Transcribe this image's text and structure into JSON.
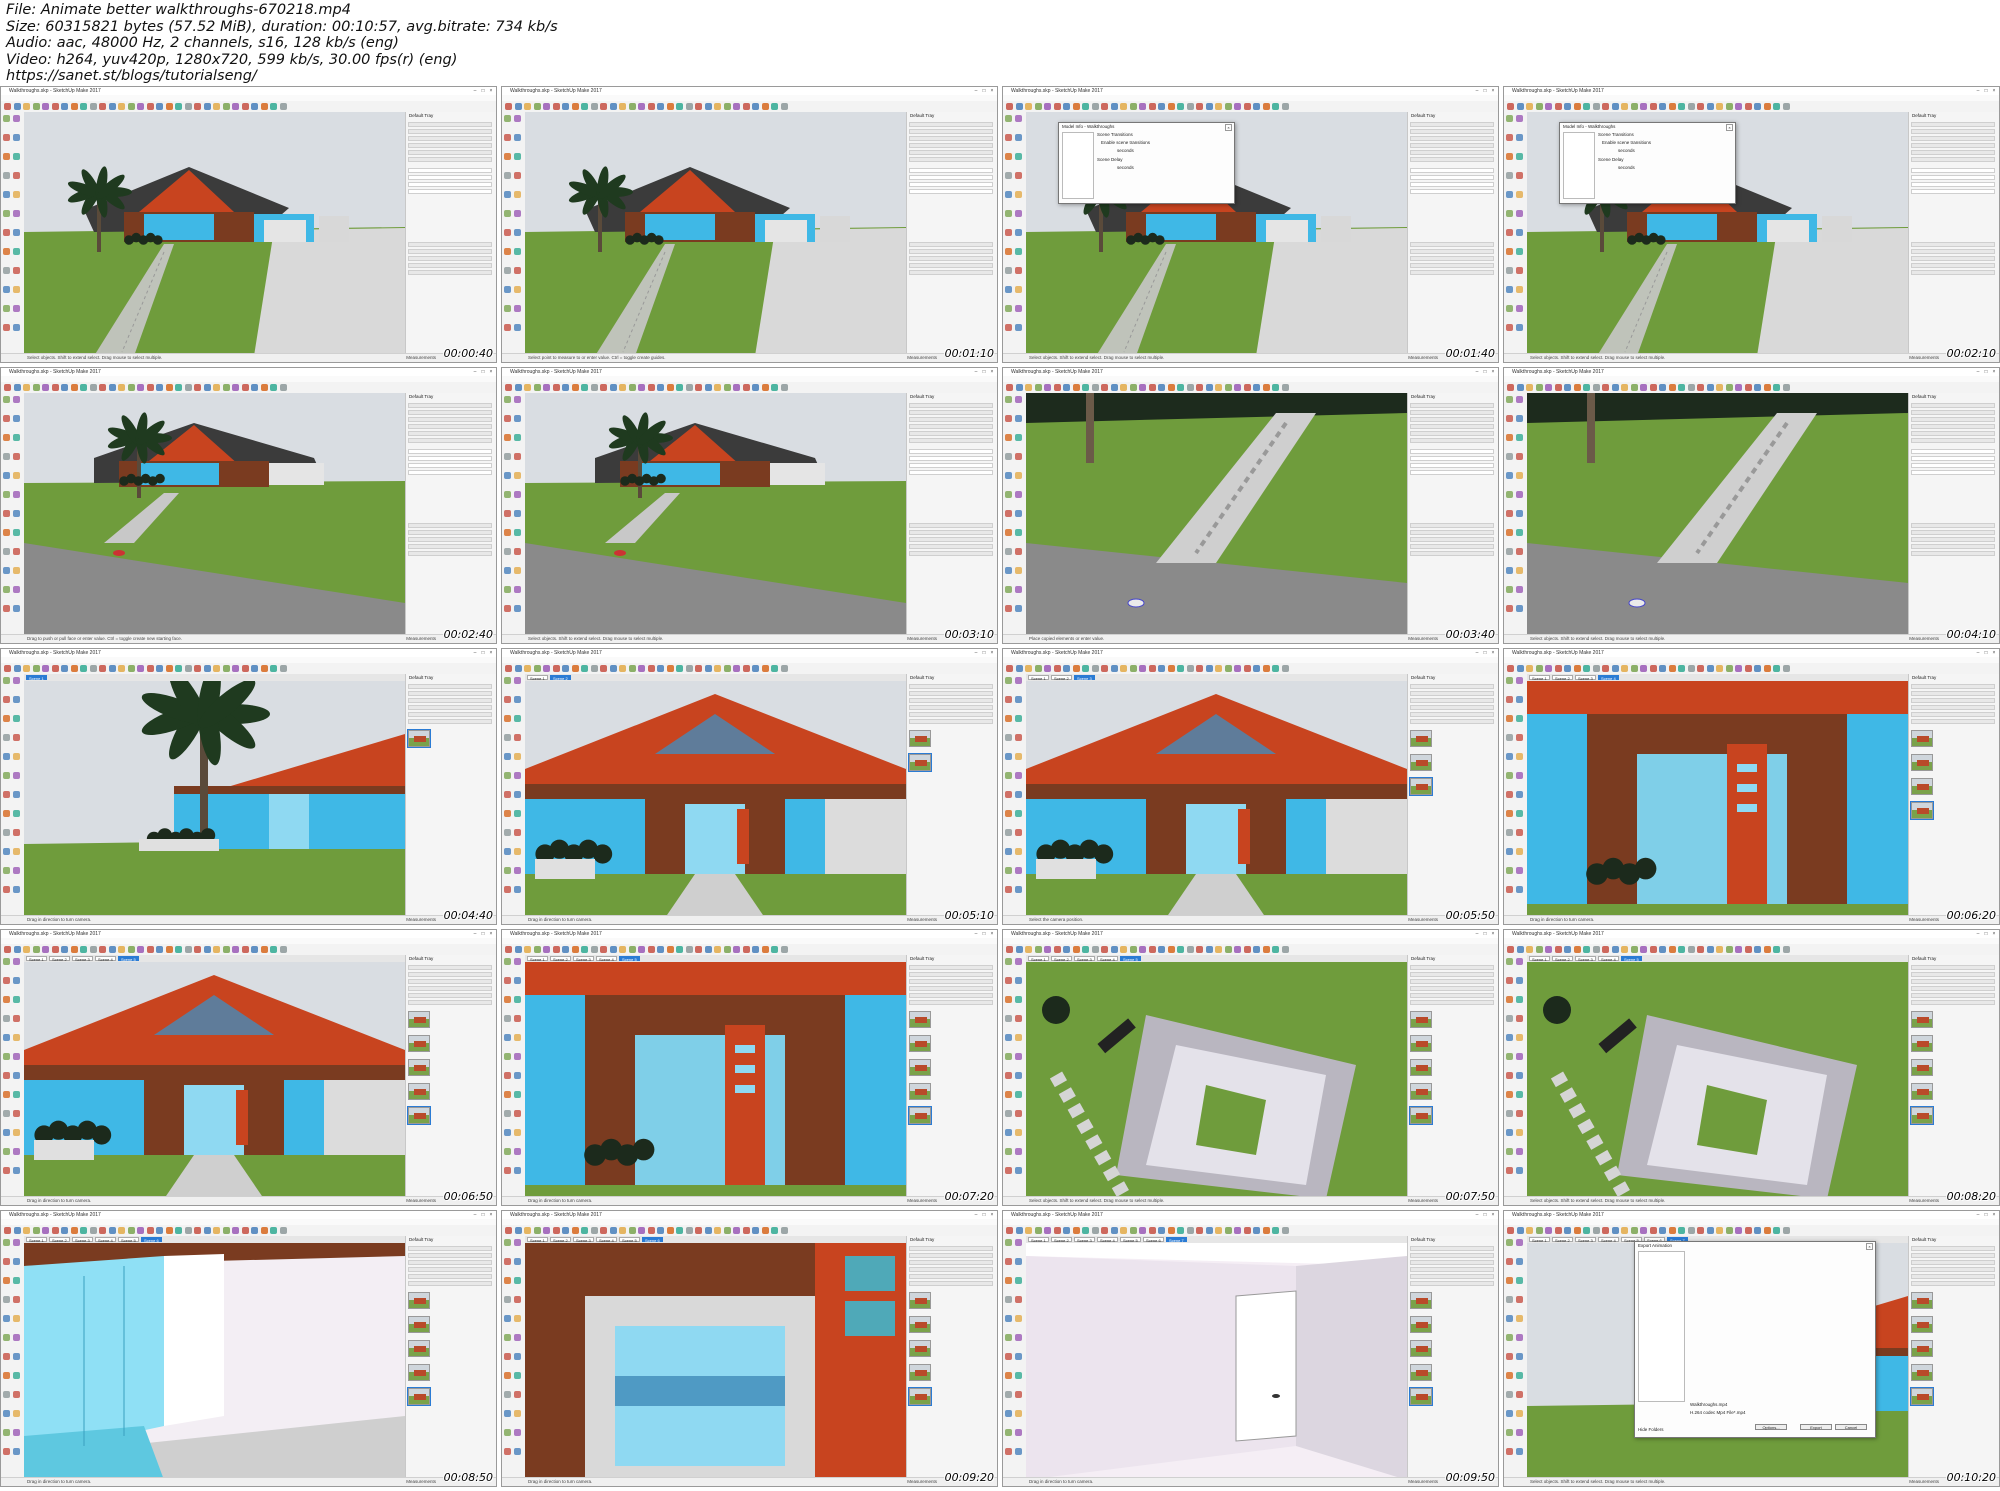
{
  "header": {
    "file_line": "File: Animate better walkthroughs-670218.mp4",
    "size_line": "Size: 60315821 bytes (57.52 MiB), duration: 00:10:57, avg.bitrate: 734 kb/s",
    "audio_line": "Audio: aac, 48000 Hz, 2 channels, s16, 128 kb/s (eng)",
    "video_line": "Video: h264, yuv420p, 1280x720, 599 kb/s, 30.00 fps(r) (eng)",
    "url_line": "https://sanet.st/blogs/tutorialseng/"
  },
  "app": {
    "window_title": "Walkthroughs.skp - SketchUp Make 2017",
    "menus": [
      "File",
      "Edit",
      "View",
      "Camera",
      "Draw",
      "Tools",
      "Window",
      "Extensions",
      "Help"
    ],
    "tray_title": "Default Tray",
    "measurements_label": "Measurements"
  },
  "colors": {
    "sky": "#d9dde2",
    "grass": "#6f9c3c",
    "road": "#8a8a8a",
    "roof": "#c8441f",
    "wall_blue": "#3fb8e6",
    "wood": "#7a3b20",
    "selection": "#2a7bd4"
  },
  "frames": [
    {
      "time": "00:00:40",
      "status": "Select objects. Shift to extend select. Drag mouse to select multiple.",
      "scene": "house",
      "tabs": []
    },
    {
      "time": "00:01:10",
      "status": "Select point to measure to or enter value.  Ctrl = toggle create guides.",
      "scene": "house",
      "tabs": []
    },
    {
      "time": "00:01:40",
      "status": "Select objects. Shift to extend select. Drag mouse to select multiple.",
      "scene": "house",
      "tabs": [],
      "dialog": {
        "title": "Model Info - Walkthroughs",
        "heading": "Scene Transitions",
        "label1": "Enable scene transitions",
        "label2": "Scene Delay",
        "unit": "seconds"
      }
    },
    {
      "time": "00:02:10",
      "status": "Select objects. Shift to extend select. Drag mouse to select multiple.",
      "scene": "house",
      "tabs": [],
      "dialog": {
        "title": "Model Info - Walkthroughs",
        "heading": "Scene Transitions",
        "label1": "Enable scene transitions",
        "label2": "Scene Delay",
        "unit": "seconds"
      }
    },
    {
      "time": "00:02:40",
      "status": "Drag to push or pull face or enter value.  Ctrl = toggle create new starting face.",
      "scene": "house-wide",
      "tabs": []
    },
    {
      "time": "00:03:10",
      "status": "Select objects. Shift to extend select. Drag mouse to select multiple.",
      "scene": "house-wide",
      "tabs": []
    },
    {
      "time": "00:03:40",
      "status": "Place copied elements or enter value.",
      "scene": "walkway",
      "tabs": []
    },
    {
      "time": "00:04:10",
      "status": "Select objects. Shift to extend select. Drag mouse to select multiple.",
      "scene": "walkway",
      "tabs": []
    },
    {
      "time": "00:04:40",
      "status": "Drag in direction to turn camera.",
      "scene": "palm-close",
      "tabs": [
        "Scene 1"
      ]
    },
    {
      "time": "00:05:10",
      "status": "Drag in direction to turn camera.",
      "scene": "front",
      "tabs": [
        "Scene 1",
        "Scene 2"
      ]
    },
    {
      "time": "00:05:50",
      "status": "Select the camera position.",
      "scene": "front",
      "tabs": [
        "Scene 1",
        "Scene 2",
        "Scene 3"
      ]
    },
    {
      "time": "00:06:20",
      "status": "Drag in direction to turn camera.",
      "scene": "door",
      "tabs": [
        "Scene 1",
        "Scene 2",
        "Scene 3",
        "Scene 4"
      ]
    },
    {
      "time": "00:06:50",
      "status": "Drag in direction to turn camera.",
      "scene": "front",
      "tabs": [
        "Scene 1",
        "Scene 2",
        "Scene 3",
        "Scene 4",
        "Scene 5"
      ]
    },
    {
      "time": "00:07:20",
      "status": "Drag in direction to turn camera.",
      "scene": "door",
      "tabs": [
        "Scene 1",
        "Scene 2",
        "Scene 3",
        "Scene 4",
        "Scene 5"
      ]
    },
    {
      "time": "00:07:50",
      "status": "Select objects. Shift to extend select. Drag mouse to select multiple.",
      "scene": "top",
      "tabs": [
        "Scene 1",
        "Scene 2",
        "Scene 3",
        "Scene 4",
        "Scene 5"
      ]
    },
    {
      "time": "00:08:20",
      "status": "Select objects. Shift to extend select. Drag mouse to select multiple.",
      "scene": "top",
      "tabs": [
        "Scene 1",
        "Scene 2",
        "Scene 3",
        "Scene 4",
        "Scene 5"
      ]
    },
    {
      "time": "00:08:50",
      "status": "Drag in direction to turn camera.",
      "scene": "interior-glass",
      "tabs": [
        "Scene 1",
        "Scene 2",
        "Scene 3",
        "Scene 4",
        "Scene 5",
        "Scene 6"
      ]
    },
    {
      "time": "00:09:20",
      "status": "Drag in direction to turn camera.",
      "scene": "interior-door",
      "tabs": [
        "Scene 1",
        "Scene 2",
        "Scene 3",
        "Scene 4",
        "Scene 5",
        "Scene 6"
      ]
    },
    {
      "time": "00:09:50",
      "status": "Drag in direction to turn camera.",
      "scene": "interior-room",
      "tabs": [
        "Scene 1",
        "Scene 2",
        "Scene 3",
        "Scene 4",
        "Scene 5",
        "Scene 6",
        "Scene 7"
      ]
    },
    {
      "time": "00:10:20",
      "status": "Select objects. Shift to extend select. Drag mouse to select multiple.",
      "scene": "palm-close",
      "tabs": [
        "Scene 1",
        "Scene 2",
        "Scene 3",
        "Scene 4",
        "Scene 5",
        "Scene 6",
        "Scene 7"
      ],
      "export_dialog": {
        "title": "Export Animation",
        "file_name": "Walkthroughs.mp4",
        "save_type": "H.264 codec Mp4 File*.mp4",
        "options": "Options...",
        "export": "Export",
        "cancel": "Cancel",
        "hide_folders": "Hide Folders"
      }
    }
  ]
}
